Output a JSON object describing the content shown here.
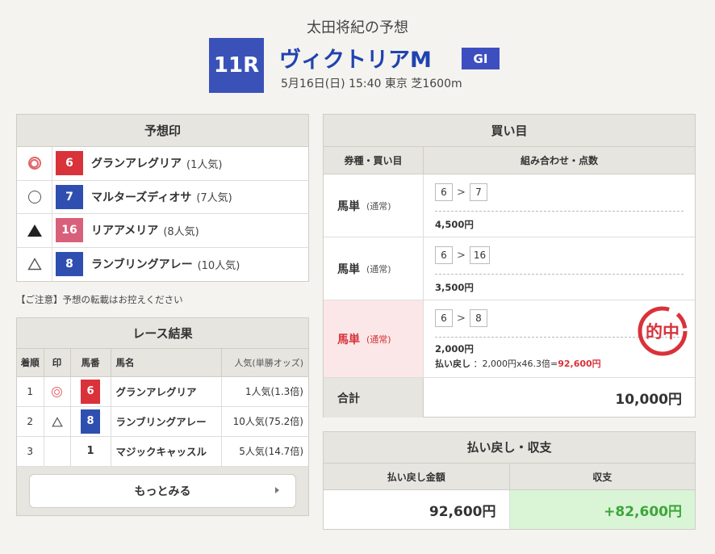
{
  "header": {
    "tipster_title": "太田将紀の予想",
    "race_number": "11R",
    "race_name": "ヴィクトリアM",
    "grade": "GI",
    "race_info": "5月16日(日) 15:40 東京 芝1600m"
  },
  "prediction": {
    "title": "予想印",
    "rows": [
      {
        "mark": "double-circle",
        "number": "6",
        "name": "グランアレグリア",
        "popularity": "(1人気)",
        "color": "#d9323a"
      },
      {
        "mark": "circle",
        "number": "7",
        "name": "マルターズディオサ",
        "popularity": "(7人気)",
        "color": "#2f4fb0"
      },
      {
        "mark": "filled-triangle",
        "number": "16",
        "name": "リアアメリア",
        "popularity": "(8人気)",
        "color": "#d9607a"
      },
      {
        "mark": "triangle",
        "number": "8",
        "name": "ランブリングアレー",
        "popularity": "(10人気)",
        "color": "#2f4fb0"
      }
    ]
  },
  "notice": "【ご注意】予想の転載はお控えください",
  "result": {
    "title": "レース結果",
    "headers": {
      "rank": "着順",
      "mark": "印",
      "number": "馬番",
      "name": "馬名",
      "popularity": "人気(単勝オッズ)"
    },
    "rows": [
      {
        "rank": "1",
        "mark": "double-circle",
        "number": "6",
        "name": "グランアレグリア",
        "popularity": "1人気(1.3倍)",
        "color": "#d9323a"
      },
      {
        "rank": "2",
        "mark": "triangle",
        "number": "8",
        "name": "ランブリングアレー",
        "popularity": "10人気(75.2倍)",
        "color": "#2f4fb0"
      },
      {
        "rank": "3",
        "mark": "",
        "number": "1",
        "name": "マジックキャッスル",
        "popularity": "5人気(14.7倍)",
        "color": ""
      }
    ],
    "more_label": "もっとみる"
  },
  "bets": {
    "title": "買い目",
    "headers": {
      "type": "券種・買い目",
      "combo": "組み合わせ・点数"
    },
    "rows": [
      {
        "type": "馬単",
        "sub": "(通常)",
        "first": "6",
        "second": "7",
        "amount": "4,500円",
        "hit": false
      },
      {
        "type": "馬単",
        "sub": "(通常)",
        "first": "6",
        "second": "16",
        "amount": "3,500円",
        "hit": false
      },
      {
        "type": "馬単",
        "sub": "(通常)",
        "first": "6",
        "second": "8",
        "amount": "2,000円",
        "hit": true,
        "payback_label": "払い戻し",
        "payback_calc": "：2,000円x46.3倍=",
        "payback_total": "92,600円"
      }
    ],
    "stamp_text": "的中",
    "total_label": "合計",
    "total_value": "10,000円"
  },
  "payback": {
    "title": "払い戻し・収支",
    "headers": {
      "payback": "払い戻し金額",
      "profit": "収支"
    },
    "payback_value": "92,600円",
    "profit_value": "+82,600円"
  }
}
